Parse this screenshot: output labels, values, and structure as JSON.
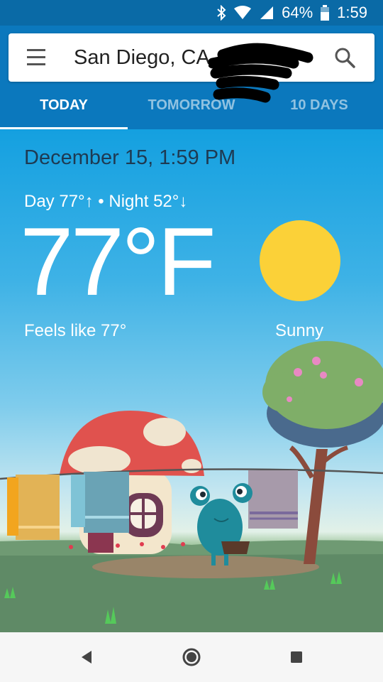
{
  "status_bar": {
    "battery": "64%",
    "time": "1:59"
  },
  "search": {
    "location": "San Diego, CA"
  },
  "tabs": [
    {
      "label": "TODAY",
      "active": true
    },
    {
      "label": "TOMORROW",
      "active": false
    },
    {
      "label": "10 DAYS",
      "active": false
    }
  ],
  "weather": {
    "date": "December 15, 1:59 PM",
    "day_night": "Day 77°↑ • Night 52°↓",
    "temperature": "77°F",
    "feels_like": "Feels like 77°",
    "condition": "Sunny"
  },
  "icons": {
    "bluetooth": "bluetooth-icon",
    "wifi": "wifi-icon",
    "signal": "signal-icon",
    "battery": "battery-icon",
    "menu": "menu-icon",
    "search": "search-icon",
    "back": "back-icon",
    "home": "home-icon",
    "recents": "recents-icon"
  },
  "colors": {
    "status_bar": "#0a6aa6",
    "header": "#0b78bd",
    "sky": "#14a0e0",
    "sun": "#fbd138",
    "date_text": "#1e3a52"
  }
}
